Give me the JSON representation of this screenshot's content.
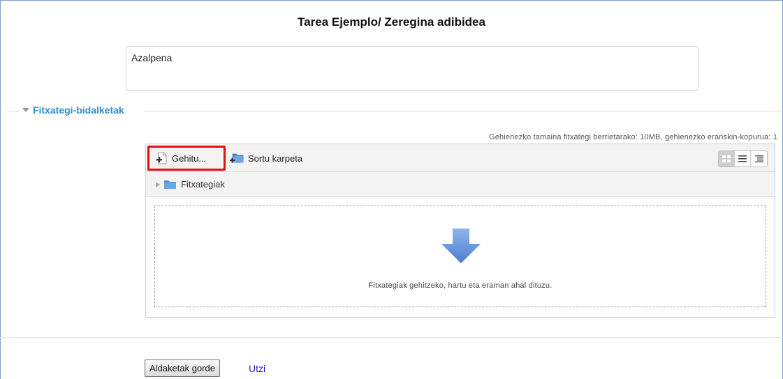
{
  "page": {
    "title": "Tarea Ejemplo/ Zeregina adibidea"
  },
  "description": {
    "text": "Azalpena"
  },
  "section": {
    "legend": "Fitxategi-bidalketak"
  },
  "filemanager": {
    "limits_text": "Gehienezko tamaina fitxategi berrietarako: 10MB, gehienezko eranskin-kopurua: 1",
    "add_label": "Gehitu...",
    "create_folder_label": "Sortu karpeta",
    "path_label": "Fitxategiak",
    "drop_text": "Fitxategiak gehitzeko, hartu eta eraman ahal dituzu.",
    "views": [
      "icons-view-icon",
      "list-view-icon",
      "tree-view-icon"
    ],
    "active_view": "icons-view-icon"
  },
  "actions": {
    "save_label": "Aldaketak gorde",
    "cancel_label": "Utzi"
  },
  "colors": {
    "legend": "#2f8ec9",
    "highlight": "#e01010",
    "link": "#1a1ad6",
    "folder": "#4f8fd6",
    "arrow": "#5b8fd6"
  }
}
